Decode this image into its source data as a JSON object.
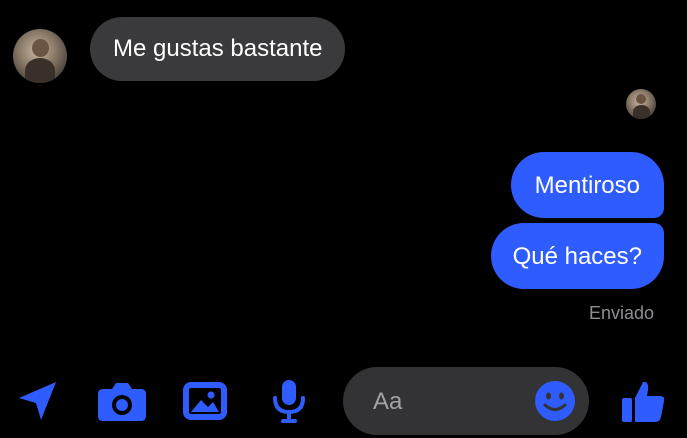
{
  "conversation": {
    "messages": [
      {
        "text": "Me gustas bastante",
        "direction": "incoming"
      },
      {
        "text": "Mentiroso",
        "direction": "outgoing"
      },
      {
        "text": "Qué haces?",
        "direction": "outgoing"
      }
    ],
    "status": "Enviado"
  },
  "composer": {
    "placeholder": "Aa"
  },
  "toolbar": {
    "icons": [
      "send-location-icon",
      "camera-icon",
      "image-icon",
      "microphone-icon",
      "emoji-icon",
      "thumbs-up-icon"
    ]
  },
  "colors": {
    "background": "#000000",
    "accent": "#2f5cff",
    "incoming_bubble": "#3a3a3c",
    "composer": "#333335",
    "status_text": "#8e8e93"
  }
}
